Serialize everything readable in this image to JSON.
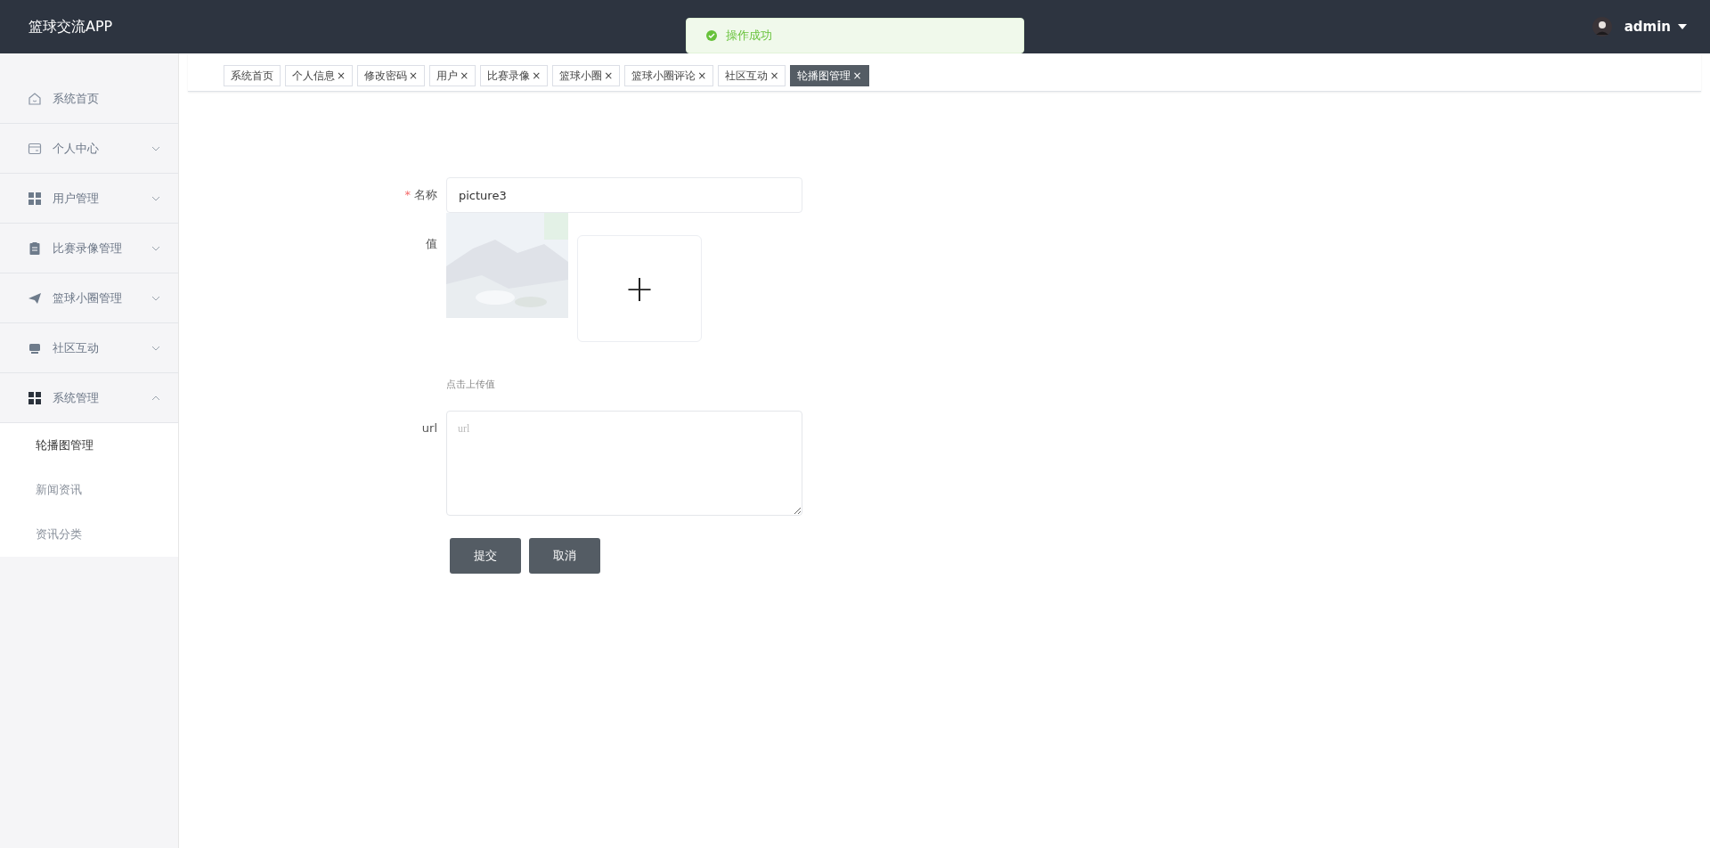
{
  "header": {
    "title": "篮球交流APP",
    "user": "admin"
  },
  "toast": {
    "message": "操作成功"
  },
  "tabs": [
    {
      "label": "系统首页",
      "selected": false
    },
    {
      "label": "个人信息",
      "close": "×",
      "selected": false
    },
    {
      "label": "修改密码",
      "close": "×",
      "selected": false
    },
    {
      "label": "用户",
      "close": "×",
      "selected": false
    },
    {
      "label": "比赛录像",
      "close": "×",
      "selected": false
    },
    {
      "label": "篮球小圈",
      "close": "×",
      "selected": false
    },
    {
      "label": "篮球小圈评论",
      "close": "×",
      "selected": false
    },
    {
      "label": "社区互动",
      "close": "×",
      "selected": false
    },
    {
      "label": "轮播图管理",
      "close": "×",
      "selected": true
    }
  ],
  "sidebar": {
    "items": [
      {
        "label": "系统首页",
        "kind": "home"
      },
      {
        "label": "个人中心",
        "kind": "card",
        "expanded": false
      },
      {
        "label": "用户管理",
        "kind": "grid",
        "expanded": false
      },
      {
        "label": "比赛录像管理",
        "kind": "clipboard",
        "expanded": false
      },
      {
        "label": "篮球小圈管理",
        "kind": "plane",
        "expanded": false
      },
      {
        "label": "社区互动",
        "kind": "store",
        "expanded": false
      },
      {
        "label": "系统管理",
        "kind": "grid-dark",
        "expanded": true,
        "children": [
          {
            "label": "轮播图管理",
            "selected": true
          },
          {
            "label": "新闻资讯",
            "selected": false
          },
          {
            "label": "资讯分类",
            "selected": false
          }
        ]
      }
    ]
  },
  "form": {
    "name": {
      "label": "名称",
      "required_mark": "*",
      "value": "picture3"
    },
    "image": {
      "label": "值",
      "hint": "点击上传值",
      "upload_symbol": "+"
    },
    "url": {
      "label": "url",
      "placeholder": "url"
    },
    "buttons": [
      "提交",
      "取消"
    ]
  }
}
